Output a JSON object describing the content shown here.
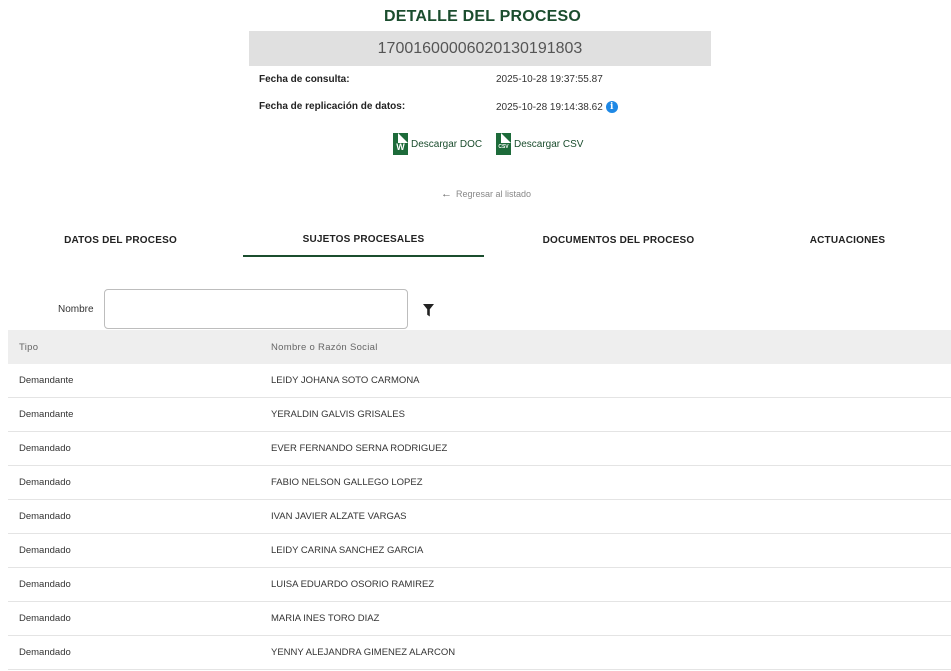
{
  "header": {
    "title": "DETALLE DEL PROCESO",
    "process_number": "17001600006020130191803"
  },
  "info": {
    "consulta_label": "Fecha de consulta:",
    "consulta_value": "2025-10-28 19:37:55.87",
    "replicacion_label": "Fecha de replicación de datos:",
    "replicacion_value": "2025-10-28 19:14:38.62"
  },
  "downloads": {
    "doc_label": "Descargar DOC",
    "doc_icon_text": "W",
    "csv_label": "Descargar CSV",
    "csv_icon_text": "CSV"
  },
  "back_link": "Regresar al listado",
  "tabs": [
    {
      "label": "DATOS DEL PROCESO",
      "active": false
    },
    {
      "label": "SUJETOS PROCESALES",
      "active": true
    },
    {
      "label": "DOCUMENTOS DEL PROCESO",
      "active": false
    },
    {
      "label": "ACTUACIONES",
      "active": false
    }
  ],
  "filter": {
    "label": "Nombre",
    "value": "",
    "placeholder": ""
  },
  "table": {
    "headers": [
      "Tipo",
      "Nombre o Razón Social"
    ],
    "rows": [
      [
        "Demandante",
        "LEIDY JOHANA SOTO CARMONA"
      ],
      [
        "Demandante",
        "YERALDIN GALVIS GRISALES"
      ],
      [
        "Demandado",
        "EVER FERNANDO SERNA RODRIGUEZ"
      ],
      [
        "Demandado",
        "FABIO NELSON GALLEGO LOPEZ"
      ],
      [
        "Demandado",
        "IVAN JAVIER ALZATE VARGAS"
      ],
      [
        "Demandado",
        "LEIDY CARINA SANCHEZ GARCIA"
      ],
      [
        "Demandado",
        "LUISA EDUARDO OSORIO RAMIREZ"
      ],
      [
        "Demandado",
        "MARIA INES TORO DIAZ"
      ],
      [
        "Demandado",
        "YENNY ALEJANDRA GIMENEZ ALARCON"
      ]
    ]
  },
  "colors": {
    "brand_green": "#1b4d2e",
    "icon_green": "#1d6b3a",
    "info_blue": "#1e88e5",
    "header_gray": "#e0e0e0"
  }
}
